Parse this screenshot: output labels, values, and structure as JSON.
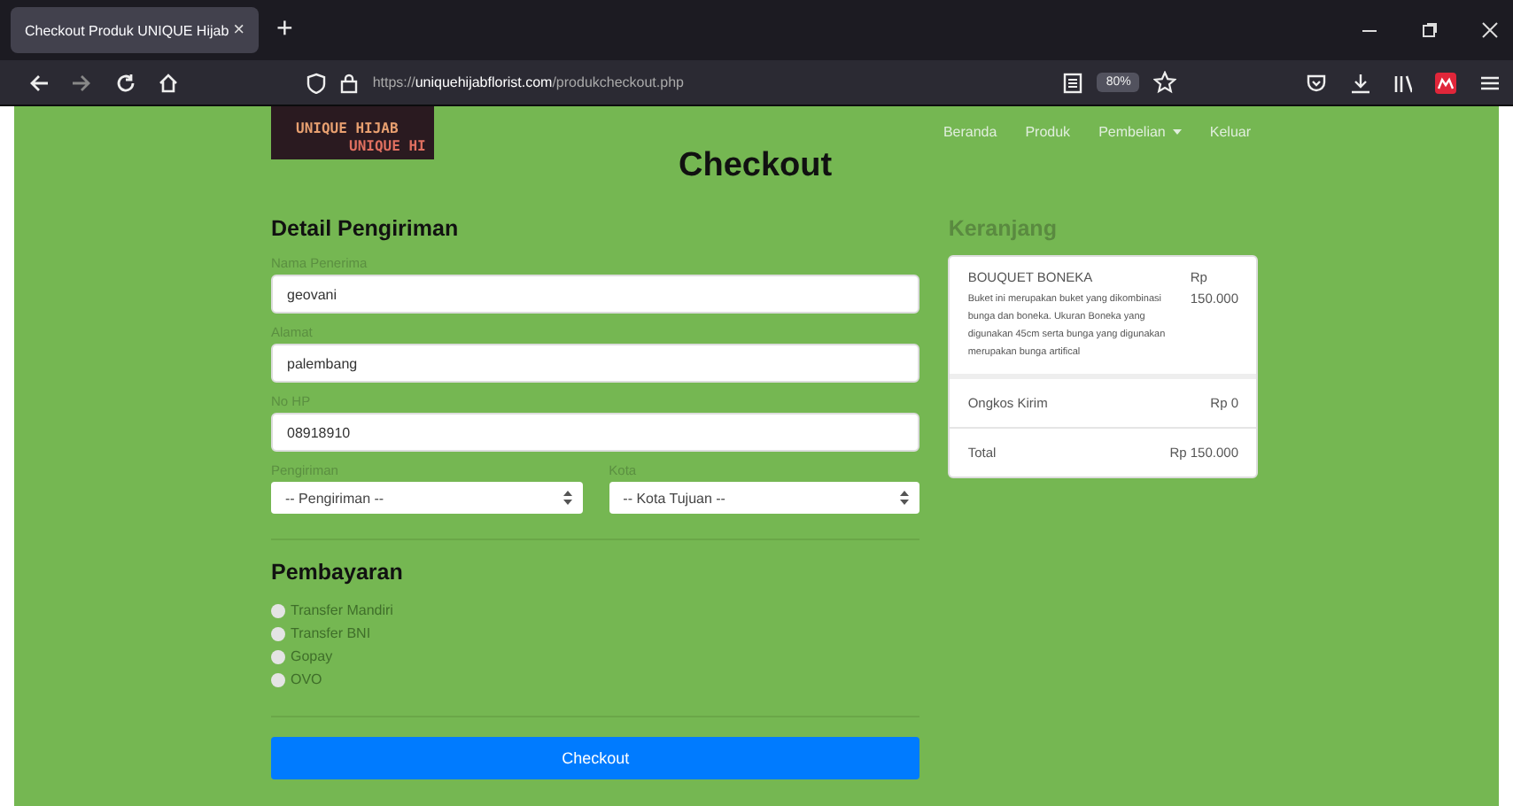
{
  "browser": {
    "tab_title": "Checkout Produk UNIQUE Hijab",
    "tab_close": "×",
    "new_tab": "+",
    "url_prefix": "https://",
    "url_host": "uniquehijabflorist.com",
    "url_path": "/produkcheckout.php",
    "zoom": "80%"
  },
  "logo": {
    "text": "UNIQUE HIJAB",
    "text_cut": "UNIQUE HI"
  },
  "nav": [
    {
      "label": "Beranda",
      "dropdown": false
    },
    {
      "label": "Produk",
      "dropdown": false
    },
    {
      "label": "Pembelian",
      "dropdown": true
    },
    {
      "label": "Keluar",
      "dropdown": false
    }
  ],
  "page_title": "Checkout",
  "shipping": {
    "title": "Detail Pengiriman",
    "fields": [
      {
        "label": "Nama Penerima",
        "value": "geovani"
      },
      {
        "label": "Alamat",
        "value": "palembang"
      },
      {
        "label": "No HP",
        "value": "08918910"
      }
    ],
    "selects": [
      {
        "label": "Pengiriman",
        "value": "-- Pengiriman --"
      },
      {
        "label": "Kota",
        "value": "-- Kota Tujuan --"
      }
    ]
  },
  "payment": {
    "title": "Pembayaran",
    "options": [
      {
        "label": "Transfer Mandiri",
        "selected": false
      },
      {
        "label": "Transfer BNI",
        "selected": false
      },
      {
        "label": "Gopay",
        "selected": false
      },
      {
        "label": "OVO",
        "selected": false
      }
    ]
  },
  "checkout_button": "Checkout",
  "cart": {
    "title": "Keranjang",
    "items": [
      {
        "name": "BOUQUET BONEKA",
        "description": "Buket ini merupakan buket yang dikombinasi bunga dan boneka. Ukuran Boneka yang digunakan 45cm serta bunga yang digunakan merupakan bunga artifical",
        "price_currency": "Rp",
        "price": "150.000"
      }
    ],
    "shipping_label": "Ongkos Kirim",
    "shipping_cost": "Rp 0",
    "total_label": "Total",
    "total": "Rp 150.000"
  }
}
